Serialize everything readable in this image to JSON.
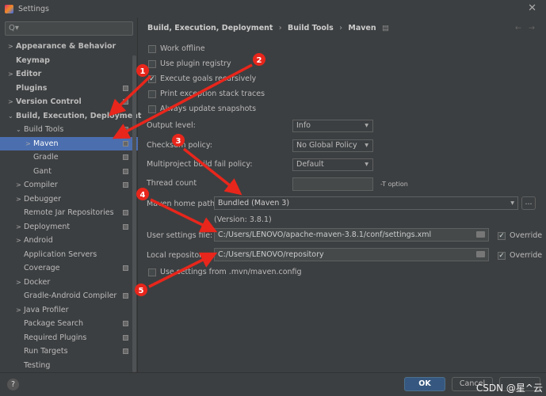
{
  "window": {
    "title": "Settings",
    "close": "✕"
  },
  "search": {
    "placeholder": "Q▾"
  },
  "sidebar": {
    "items": [
      {
        "label": "Appearance & Behavior",
        "level": 0,
        "arrow": ">",
        "bold": true
      },
      {
        "label": "Keymap",
        "level": 0,
        "bold": true
      },
      {
        "label": "Editor",
        "level": 0,
        "arrow": ">",
        "bold": true
      },
      {
        "label": "Plugins",
        "level": 0,
        "bold": true,
        "badge": true
      },
      {
        "label": "Version Control",
        "level": 0,
        "arrow": ">",
        "bold": true,
        "badge": true
      },
      {
        "label": "Build, Execution, Deployment",
        "level": 0,
        "arrow": "⌄",
        "bold": true
      },
      {
        "label": "Build Tools",
        "level": 1,
        "arrow": "⌄",
        "badge": true
      },
      {
        "label": "Maven",
        "level": 2,
        "arrow": ">",
        "badge": true,
        "selected": true
      },
      {
        "label": "Gradle",
        "level": 2,
        "badge": true
      },
      {
        "label": "Gant",
        "level": 2,
        "badge": true
      },
      {
        "label": "Compiler",
        "level": 1,
        "arrow": ">",
        "badge": true
      },
      {
        "label": "Debugger",
        "level": 1,
        "arrow": ">"
      },
      {
        "label": "Remote Jar Repositories",
        "level": 1,
        "badge": true
      },
      {
        "label": "Deployment",
        "level": 1,
        "arrow": ">",
        "badge": true
      },
      {
        "label": "Android",
        "level": 1,
        "arrow": ">"
      },
      {
        "label": "Application Servers",
        "level": 1
      },
      {
        "label": "Coverage",
        "level": 1,
        "badge": true
      },
      {
        "label": "Docker",
        "level": 1,
        "arrow": ">"
      },
      {
        "label": "Gradle-Android Compiler",
        "level": 1,
        "badge": true
      },
      {
        "label": "Java Profiler",
        "level": 1,
        "arrow": ">"
      },
      {
        "label": "Package Search",
        "level": 1,
        "badge": true
      },
      {
        "label": "Required Plugins",
        "level": 1,
        "badge": true
      },
      {
        "label": "Run Targets",
        "level": 1,
        "badge": true
      },
      {
        "label": "Testing",
        "level": 1
      }
    ]
  },
  "breadcrumb": [
    "Build, Execution, Deployment",
    "›",
    "Build Tools",
    "›",
    "Maven"
  ],
  "nav": {
    "back": "←",
    "forward": "→"
  },
  "checkboxes": [
    {
      "label": "Work offline",
      "checked": false
    },
    {
      "label": "Use plugin registry",
      "checked": false
    },
    {
      "label": "Execute goals recursively",
      "checked": true
    },
    {
      "label": "Print exception stack traces",
      "checked": false
    },
    {
      "label": "Always update snapshots",
      "checked": false
    }
  ],
  "output_level": {
    "label": "Output level:",
    "value": "Info"
  },
  "checksum": {
    "label": "Checksum policy:",
    "value": "No Global Policy"
  },
  "failpolicy": {
    "label": "Multiproject build fail policy:",
    "value": "Default"
  },
  "thread": {
    "label": "Thread count",
    "value": "",
    "suffix": "-T option"
  },
  "maven_home": {
    "label": "Maven home path:",
    "value": "Bundled (Maven 3)",
    "browse": "...",
    "version": "(Version: 3.8.1)"
  },
  "user_settings": {
    "label": "User settings file:",
    "value": "C:/Users/LENOVO/apache-maven-3.8.1/conf/settings.xml",
    "override": "Override"
  },
  "local_repo": {
    "label": "Local repository:",
    "value": "C:/Users/LENOVO/repository",
    "override": "Override"
  },
  "mvn_config": {
    "label": "Use settings from .mvn/maven.config",
    "checked": false
  },
  "footer": {
    "help": "?",
    "ok": "OK",
    "cancel": "Cancel",
    "watermark": "CSDN @星^云"
  },
  "annotations": {
    "color": "#e8261c",
    "labels": [
      "1",
      "2",
      "3",
      "4",
      "5"
    ]
  }
}
